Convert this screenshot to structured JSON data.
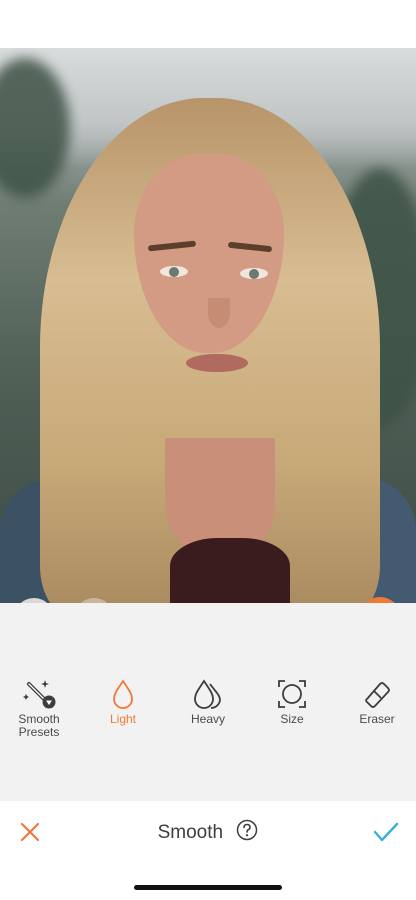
{
  "photo": {
    "subject": "portrait",
    "controls": {
      "undo": "undo-icon",
      "redo": "redo-icon",
      "compare": "compare-icon"
    }
  },
  "tools": [
    {
      "label": "Smooth\nPresets",
      "icon": "smooth-presets-icon",
      "active": false
    },
    {
      "label": "Light",
      "icon": "light-drop-icon",
      "active": true
    },
    {
      "label": "Heavy",
      "icon": "heavy-drops-icon",
      "active": false
    },
    {
      "label": "Size",
      "icon": "size-icon",
      "active": false
    },
    {
      "label": "Eraser",
      "icon": "eraser-icon",
      "active": false
    }
  ],
  "bottom_bar": {
    "title": "Smooth",
    "help_icon": "help-icon",
    "cancel_icon": "close-icon",
    "confirm_icon": "check-icon"
  },
  "colors": {
    "accent": "#ee7a38",
    "confirm": "#3aaee0",
    "toolbar_bg": "#f2f2f2",
    "text": "#4a4a4a"
  }
}
